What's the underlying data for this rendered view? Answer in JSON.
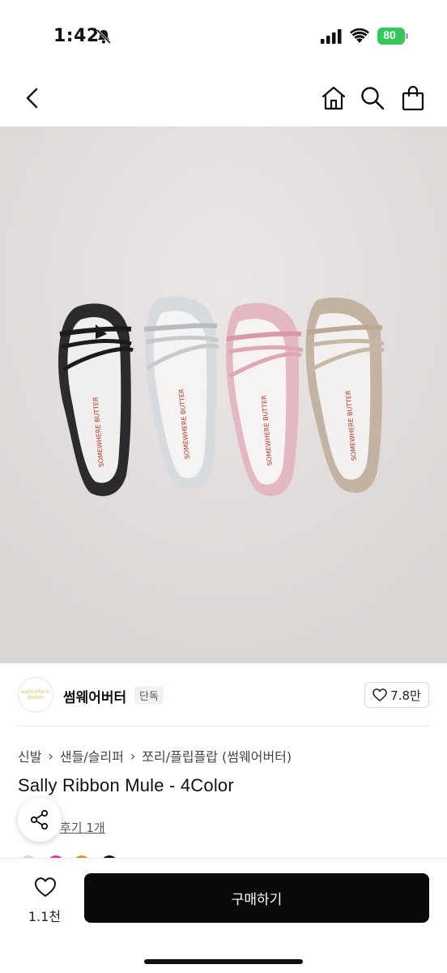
{
  "status_bar": {
    "time": "1:42",
    "battery": "80"
  },
  "seller": {
    "logo_text": "somewhere butter",
    "name": "썸웨어버터",
    "badge": "단독",
    "likes": "7.8만"
  },
  "breadcrumb": [
    "신발",
    "샌들/슬리퍼",
    "쪼리/플립플랍 (썸웨어버터)"
  ],
  "product": {
    "title": "Sally Ribbon Mule - 4Color",
    "review_link": "후기 1개",
    "insole_text": "SOMEWHERE BUTTER"
  },
  "colors": {
    "sandals": [
      "#2a2a2c",
      "#d9dcdf",
      "#e5bcc4",
      "#c2b2a2"
    ],
    "swatches": [
      "#d8d8d8",
      "#d63aa6",
      "#c99b2d",
      "#111111"
    ],
    "accent": "#0a0a0a",
    "battery": "#34c759"
  },
  "bottom_bar": {
    "wish_count": "1.1천",
    "buy_label": "구매하기"
  },
  "icons": [
    "bell-slash-icon",
    "signal-icon",
    "wifi-icon",
    "battery-icon",
    "back-icon",
    "home-icon",
    "search-icon",
    "bag-icon",
    "heart-icon",
    "share-icon"
  ]
}
